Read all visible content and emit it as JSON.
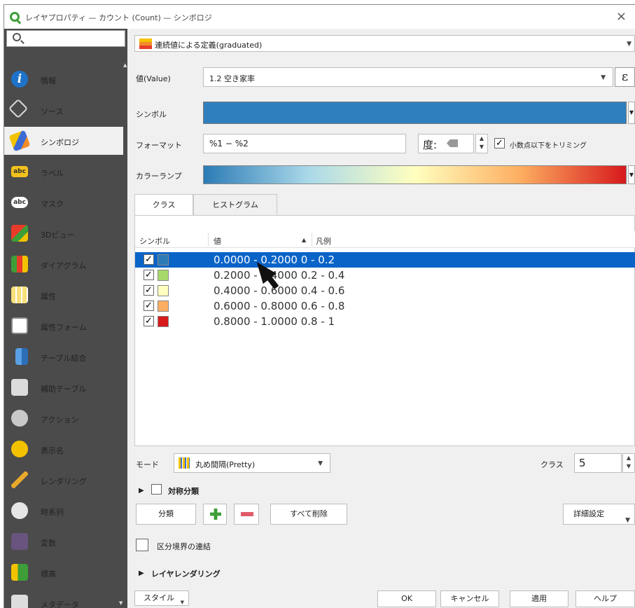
{
  "window": {
    "title": "レイヤプロパティ — カウント (Count) — シンボロジ",
    "close": "×"
  },
  "sidebar": {
    "items": [
      {
        "label": "情報",
        "icon": "info-icon"
      },
      {
        "label": "ソース",
        "icon": "source-icon"
      },
      {
        "label": "シンボロジ",
        "icon": "symbology-icon"
      },
      {
        "label": "ラベル",
        "icon": "labels-icon"
      },
      {
        "label": "マスク",
        "icon": "mask-icon"
      },
      {
        "label": "3Dビュー",
        "icon": "3d-view-icon"
      },
      {
        "label": "ダイアグラム",
        "icon": "diagrams-icon"
      },
      {
        "label": "属性",
        "icon": "fields-icon"
      },
      {
        "label": "属性フォーム",
        "icon": "attributes-form-icon"
      },
      {
        "label": "テーブル結合",
        "icon": "joins-icon"
      },
      {
        "label": "補助テーブル",
        "icon": "auxiliary-storage-icon"
      },
      {
        "label": "アクション",
        "icon": "actions-icon"
      },
      {
        "label": "表示名",
        "icon": "display-icon"
      },
      {
        "label": "レンダリング",
        "icon": "rendering-icon"
      },
      {
        "label": "時系列",
        "icon": "temporal-icon"
      },
      {
        "label": "変数",
        "icon": "variables-icon"
      },
      {
        "label": "標高",
        "icon": "elevation-icon"
      },
      {
        "label": "メタデータ",
        "icon": "metadata-icon"
      }
    ],
    "icon_labels": {
      "labels": "abc",
      "mask": "abc",
      "info": "i"
    }
  },
  "renderer": {
    "label": "連続値による定義(graduated)"
  },
  "form": {
    "value_label": "値(Value)",
    "value": "1.2  空き家率",
    "expression_btn": "ε",
    "symbol_label": "シンボル",
    "symbol_color": "#2f7fbf",
    "format_label": "フォーマット",
    "format_value": "%1 − %2",
    "precision_value": "度:",
    "trim_checked": true,
    "trim_label": "小数点以下をトリミング",
    "color_ramp_label": "カラーランプ"
  },
  "tabs": [
    {
      "label": "クラス",
      "active": true
    },
    {
      "label": "ヒストグラム",
      "active": false
    }
  ],
  "table": {
    "headers": {
      "symbol": "シンボル",
      "value": "値",
      "legend": "凡例",
      "sort": "▲"
    },
    "rows": [
      {
        "checked": true,
        "color": "#2c7bb6",
        "range": "0.0000 - 0.2000",
        "legend": "0 - 0.2",
        "selected": true
      },
      {
        "checked": true,
        "color": "#a6d96a",
        "range": "0.2000 - 0.4000",
        "legend": "0.2 - 0.4",
        "selected": false
      },
      {
        "checked": true,
        "color": "#ffffbf",
        "range": "0.4000 - 0.6000",
        "legend": "0.4 - 0.6",
        "selected": false
      },
      {
        "checked": true,
        "color": "#fdae61",
        "range": "0.6000 - 0.8000",
        "legend": "0.6 - 0.8",
        "selected": false
      },
      {
        "checked": true,
        "color": "#d7191c",
        "range": "0.8000 - 1.0000",
        "legend": "0.8 - 1",
        "selected": false
      }
    ],
    "check_mark": "✓"
  },
  "mode": {
    "label": "モード",
    "value": "丸め間隔(Pretty)"
  },
  "classes": {
    "label": "クラス",
    "value": "5"
  },
  "symmetric": {
    "label": "対称分類",
    "checked": false
  },
  "buttons": {
    "classify": "分類",
    "delete_all": "すべて削除",
    "advanced": "詳細設定",
    "link_boundaries": "区分境界の連結"
  },
  "layer_rendering": {
    "label": "レイヤレンダリング"
  },
  "footer": {
    "style": "スタイル",
    "ok": "OK",
    "cancel": "キャンセル",
    "apply": "適用",
    "help": "ヘルプ"
  }
}
